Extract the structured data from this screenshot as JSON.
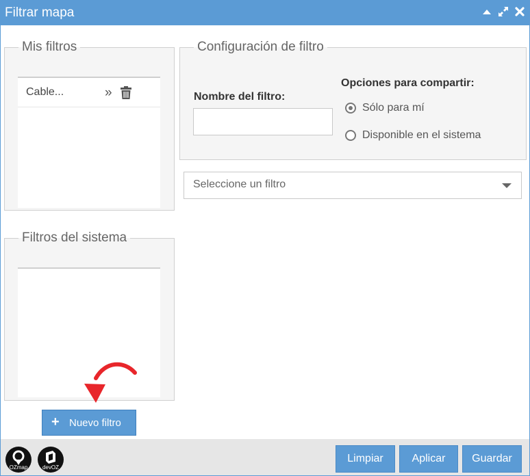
{
  "window": {
    "title": "Filtrar mapa",
    "accent_color": "#5b9bd5",
    "controls": [
      "collapse-icon",
      "expand-icon",
      "close-icon"
    ]
  },
  "my_filters": {
    "legend": "Mis filtros",
    "items": [
      {
        "label": "Cable...",
        "actions": [
          "apply-icon",
          "trash-icon"
        ]
      }
    ]
  },
  "system_filters": {
    "legend": "Filtros del sistema",
    "items": []
  },
  "config": {
    "legend": "Configuración de filtro",
    "name_label": "Nombre del filtro:",
    "name_value": "",
    "share_label": "Opciones para compartir:",
    "share_options": [
      {
        "label": "Sólo para mí",
        "selected": true
      },
      {
        "label": "Disponible en el sistema",
        "selected": false
      }
    ]
  },
  "filter_select": {
    "placeholder": "Seleccione un filtro"
  },
  "new_filter_button": {
    "label": "Nuevo filtro",
    "icon": "plus-icon"
  },
  "annotation": {
    "icon": "red-curved-arrow-icon",
    "color": "#e8262b"
  },
  "footer": {
    "logos": [
      {
        "name": "ozmap-logo",
        "text": "OZmap"
      },
      {
        "name": "devoz-logo",
        "text": "devOZ"
      }
    ],
    "buttons": {
      "clear": "Limpiar",
      "apply": "Aplicar",
      "save": "Guardar"
    }
  }
}
